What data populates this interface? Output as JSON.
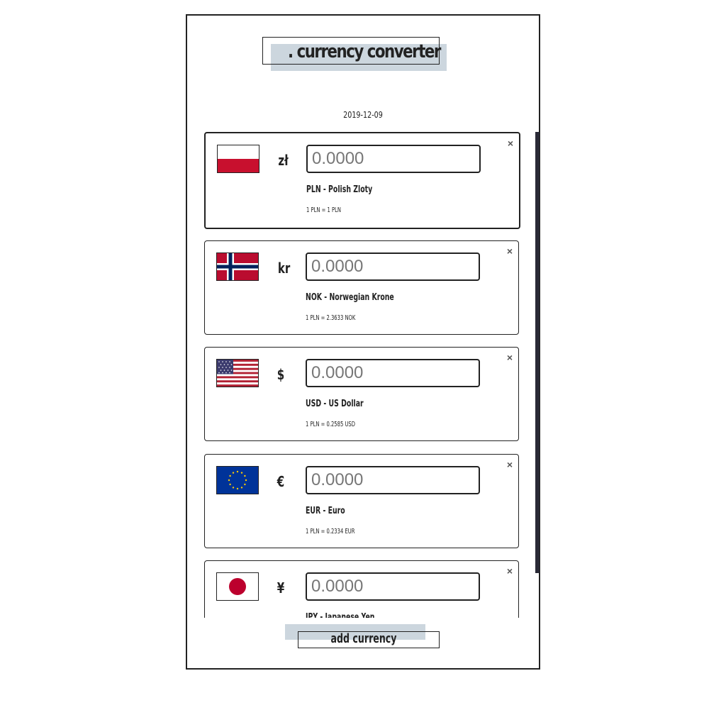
{
  "app": {
    "title": ". currency converter",
    "date": "2019-12-09"
  },
  "currencies": [
    {
      "code": "PLN",
      "symbol": "zł",
      "name": "PLN - Polish Zloty",
      "rate": "1 PLN = 1 PLN",
      "value": "",
      "placeholder": "0.0000",
      "flag_icon": "poland-flag-icon"
    },
    {
      "code": "NOK",
      "symbol": "kr",
      "name": "NOK - Norwegian Krone",
      "rate": "1 PLN = 2.3633 NOK",
      "value": "",
      "placeholder": "0.0000",
      "flag_icon": "norway-flag-icon"
    },
    {
      "code": "USD",
      "symbol": "$",
      "name": "USD - US Dollar",
      "rate": "1 PLN = 0.2585 USD",
      "value": "",
      "placeholder": "0.0000",
      "flag_icon": "usa-flag-icon"
    },
    {
      "code": "EUR",
      "symbol": "€",
      "name": "EUR - Euro",
      "rate": "1 PLN = 0.2334 EUR",
      "value": "",
      "placeholder": "0.0000",
      "flag_icon": "eu-flag-icon"
    },
    {
      "code": "JPY",
      "symbol": "¥",
      "name": "JPY - Japanese Yen",
      "rate": "",
      "value": "",
      "placeholder": "0.0000",
      "flag_icon": "japan-flag-icon"
    }
  ],
  "remove_label": "×",
  "add_button": {
    "label": "add currency"
  },
  "colors": {
    "accent_shadow": "#ccd6de",
    "border": "#222222",
    "scrollbar": "#2a2a36"
  }
}
